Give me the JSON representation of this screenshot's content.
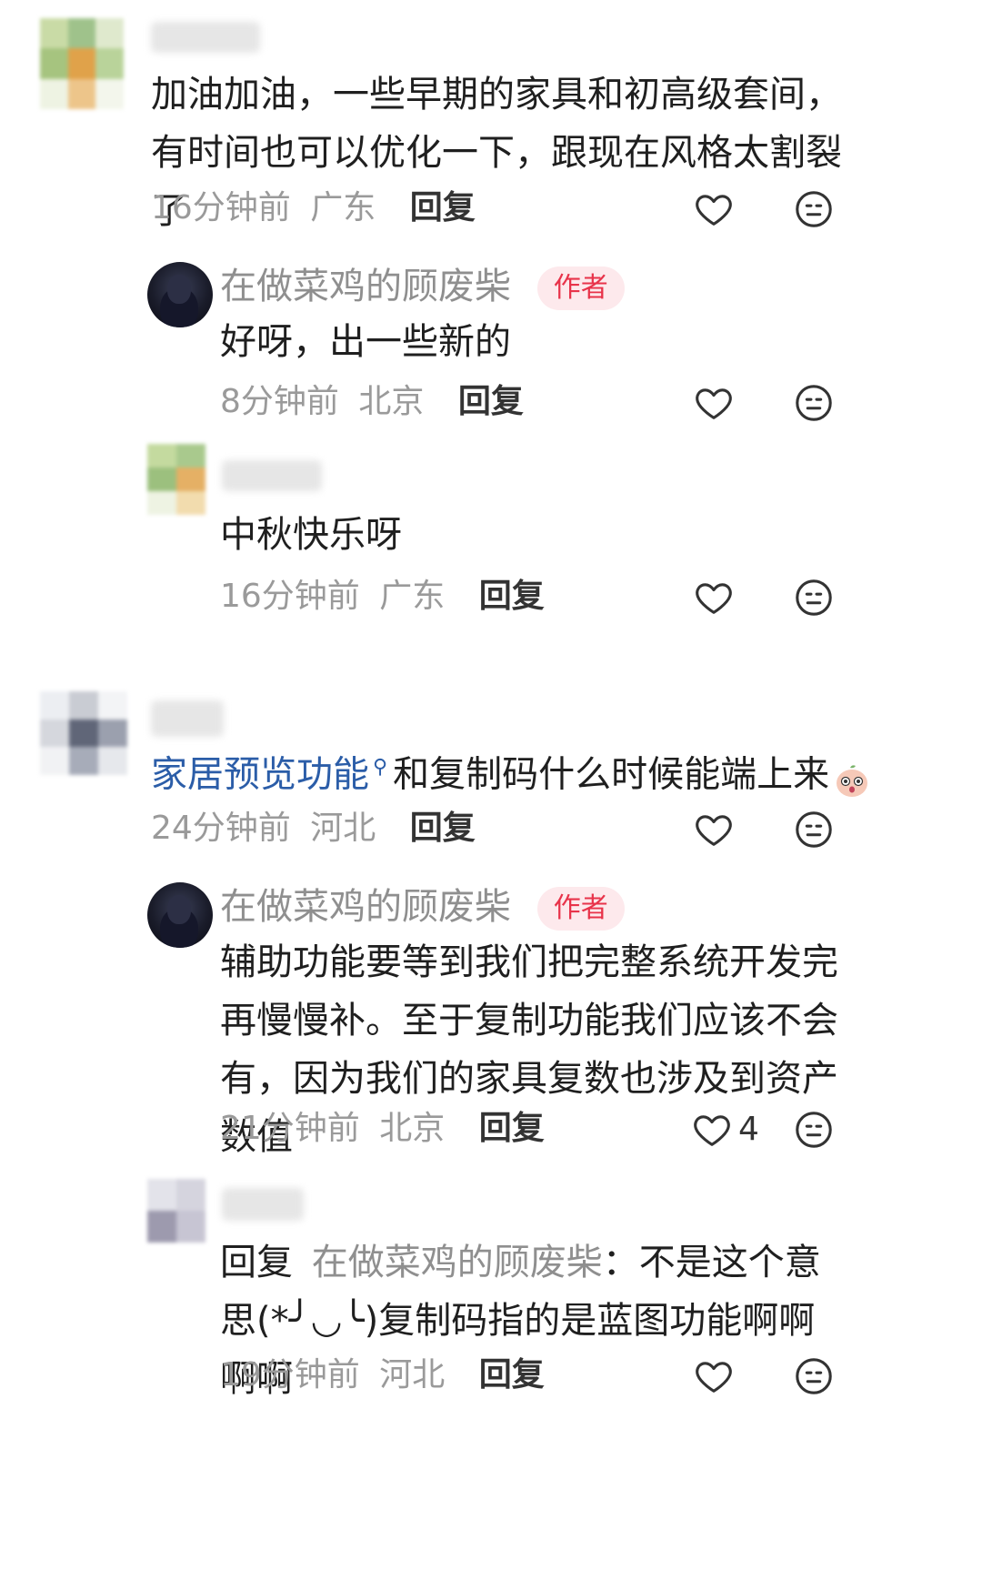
{
  "comments": [
    {
      "text": "加油加油，一些早期的家具和初高级套间，有时间也可以优化一下，跟现在风格太割裂了",
      "meta": {
        "time": "16分钟前",
        "location": "广东",
        "reply_label": "回复"
      },
      "replies": [
        {
          "author": "在做菜鸡的顾废柴",
          "badge": "作者",
          "text": "好呀，出一些新的",
          "meta": {
            "time": "8分钟前",
            "location": "北京",
            "reply_label": "回复"
          }
        },
        {
          "text": "中秋快乐呀",
          "meta": {
            "time": "16分钟前",
            "location": "广东",
            "reply_label": "回复"
          }
        }
      ]
    },
    {
      "link_text": "家居预览功能",
      "text": "和复制码什么时候能端上来",
      "meta": {
        "time": "24分钟前",
        "location": "河北",
        "reply_label": "回复"
      },
      "replies": [
        {
          "author": "在做菜鸡的顾废柴",
          "badge": "作者",
          "text": "辅助功能要等到我们把完整系统开发完再慢慢补。至于复制功能我们应该不会有，因为我们的家具复数也涉及到资产数值",
          "meta": {
            "time": "21分钟前",
            "location": "北京",
            "reply_label": "回复"
          },
          "likes": "4"
        },
        {
          "reply_prefix": "回复",
          "reply_to": "在做菜鸡的顾废柴",
          "text": "：不是这个意思(*╯◡╰)复制码指的是蓝图功能啊啊啊啊",
          "meta": {
            "time": "19分钟前",
            "location": "河北",
            "reply_label": "回复"
          }
        }
      ]
    }
  ],
  "icons": {
    "like": "heart-outline-icon",
    "dislike": "meh-face-icon",
    "search": "search-icon"
  },
  "colors": {
    "badge_bg": "#fde9ec",
    "badge_text": "#e8334a",
    "link": "#2b5da8"
  }
}
